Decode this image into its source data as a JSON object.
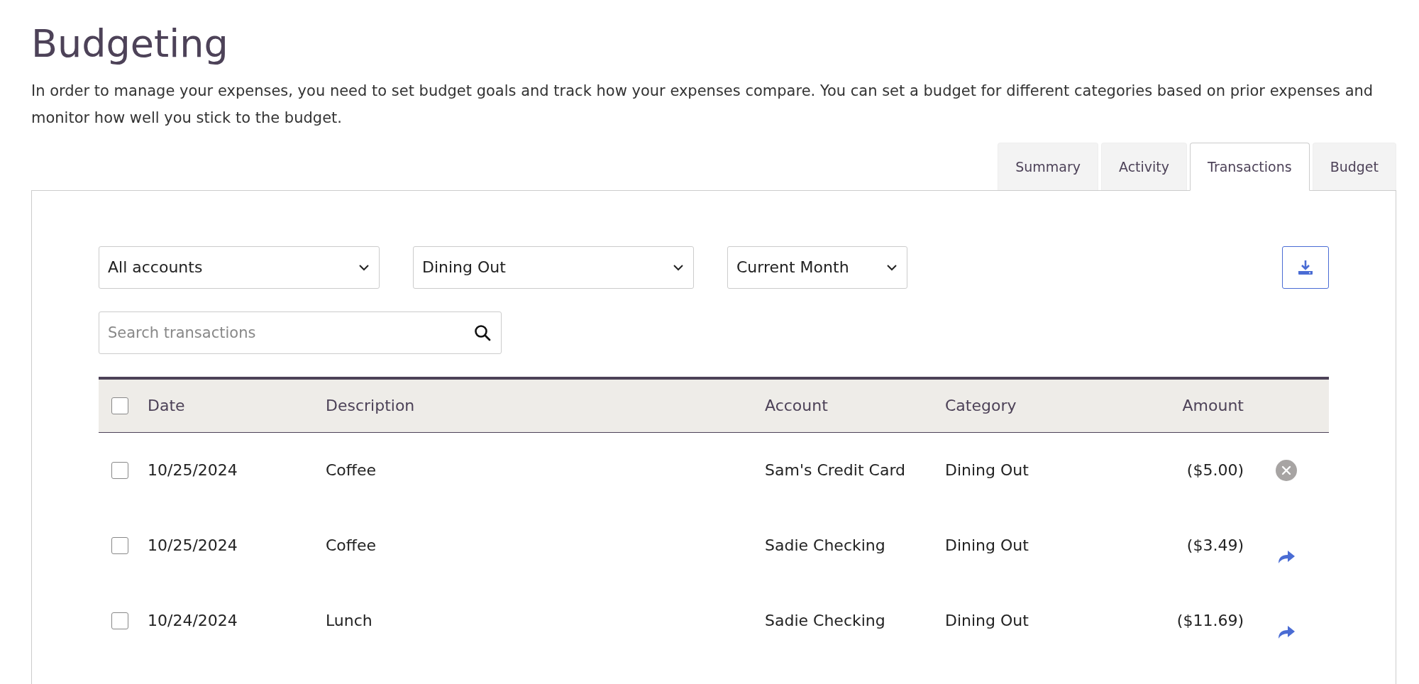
{
  "page": {
    "title": "Budgeting",
    "description": "In order to manage your expenses, you need to set budget goals and track how your expenses compare. You can set a budget for different categories based on prior expenses and monitor how well you stick to the budget."
  },
  "tabs": [
    {
      "label": "Summary",
      "selected": false
    },
    {
      "label": "Activity",
      "selected": false
    },
    {
      "label": "Transactions",
      "selected": true
    },
    {
      "label": "Budget",
      "selected": false
    }
  ],
  "filters": [
    {
      "value": "All accounts"
    },
    {
      "value": "Dining Out"
    },
    {
      "value": "Current Month"
    }
  ],
  "search": {
    "placeholder": "Search transactions"
  },
  "table": {
    "columns": [
      "Date",
      "Description",
      "Account",
      "Category",
      "Amount"
    ],
    "select_all_checked": false,
    "rows": [
      {
        "checked": false,
        "date": "10/25/2024",
        "description": "Coffee",
        "account": "Sam's Credit Card",
        "category": "Dining Out",
        "amount": "($5.00)",
        "kind": "remove"
      },
      {
        "checked": false,
        "date": "10/25/2024",
        "description": "Coffee",
        "account": "Sadie Checking",
        "category": "Dining Out",
        "amount": "($3.49)",
        "kind": "forward"
      },
      {
        "checked": false,
        "date": "10/24/2024",
        "description": "Lunch",
        "account": "Sadie Checking",
        "category": "Dining Out",
        "amount": "($11.69)",
        "kind": "forward"
      }
    ]
  }
}
